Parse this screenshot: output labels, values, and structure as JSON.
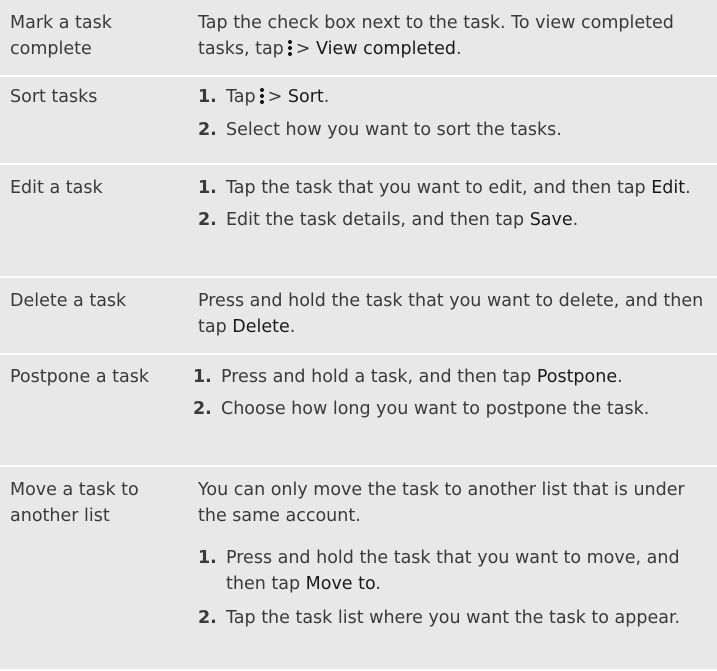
{
  "rows": [
    {
      "label": "Mark a task complete",
      "p1": "Tap the check box next to the task. To view completed tasks, tap",
      "p1_b": "> ",
      "p1_link": "View completed",
      "p1_end": "."
    },
    {
      "label": "Sort tasks",
      "s1_num": "1.",
      "s1_a": "Tap",
      "s1_b": "> ",
      "s1_link": "Sort",
      "s1_end": ".",
      "s2_num": "2.",
      "s2": "Select how you want to sort the tasks."
    },
    {
      "label": "Edit a task",
      "s1_num": "1.",
      "s1_a": "Tap the task that you want to edit, and then tap ",
      "s1_link": "Edit",
      "s1_end": ".",
      "s2_num": "2.",
      "s2_a": "Edit the task details, and then tap ",
      "s2_link": "Save",
      "s2_end": "."
    },
    {
      "label": "Delete a task",
      "p1": "Press and hold the task that you want to delete, and then tap ",
      "p1_link": "Delete",
      "p1_end": "."
    },
    {
      "label": "Postpone a task",
      "s1_num": "1.",
      "s1_a": "Press and hold a task, and then tap ",
      "s1_link": "Postpone",
      "s1_end": ".",
      "s2_num": "2.",
      "s2": "Choose how long you want to postpone the task."
    },
    {
      "label": "Move a task to another list",
      "p1": "You can only move the task to another list that is under the same account.",
      "s1_num": "1.",
      "s1_a": "Press and hold the task that you want to move, and then tap ",
      "s1_link": "Move to",
      "s1_end": ".",
      "s2_num": "2.",
      "s2": "Tap the task list where you want the task to appear."
    }
  ],
  "icons": {
    "menu": "more-vertical-icon"
  }
}
